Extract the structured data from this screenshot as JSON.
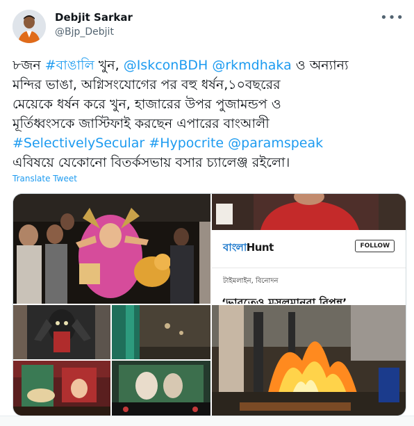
{
  "user": {
    "name": "Debjit Sarkar",
    "handle": "@Bjp_Debjit",
    "more_icon": "more-dots-icon"
  },
  "tweet": {
    "lines": [
      [
        {
          "text": "৮জন ",
          "link": false
        },
        {
          "text": "#বাঙালি",
          "link": true
        },
        {
          "text": " খুন, ",
          "link": false
        },
        {
          "text": "@IskconBDH",
          "link": true
        },
        {
          "text": " ",
          "link": false
        },
        {
          "text": "@rkmdhaka",
          "link": true
        },
        {
          "text": " ও অন্যান্য",
          "link": false
        }
      ],
      [
        {
          "text": "মন্দির ভাঙা, অগ্নিসংযোগের পর বহু ধর্ষন,১০বছরের",
          "link": false
        }
      ],
      [
        {
          "text": "মেয়েকে ধর্ষন করে খুন, হাজারের উপর পুজামন্ডপ ও",
          "link": false
        }
      ],
      [
        {
          "text": "মূর্তিধ্বংসকে জাস্টিফাই করছেন এপারের বাংআলী",
          "link": false
        }
      ],
      [
        {
          "text": "#SelectivelySecular",
          "link": true
        },
        {
          "text": " ",
          "link": false
        },
        {
          "text": "#Hypocrite",
          "link": true
        },
        {
          "text": "  ",
          "link": false
        },
        {
          "text": "@paramspeak",
          "link": true
        }
      ],
      [
        {
          "text": "এবিষয়ে যেকোনো বিতর্কসভায় বসার চ্যালেঞ্জ রইলো।",
          "link": false
        }
      ]
    ],
    "translate_label": "Translate Tweet"
  },
  "media": {
    "card": {
      "logo_bengali": "বাংলা",
      "logo_latin": "Hunt",
      "follow_label": "FOLLOW",
      "category": "টাইমলাইন, বিনোদন",
      "headline": "‘ভারতেও মুসলমানরা বিপন্ন’"
    }
  }
}
